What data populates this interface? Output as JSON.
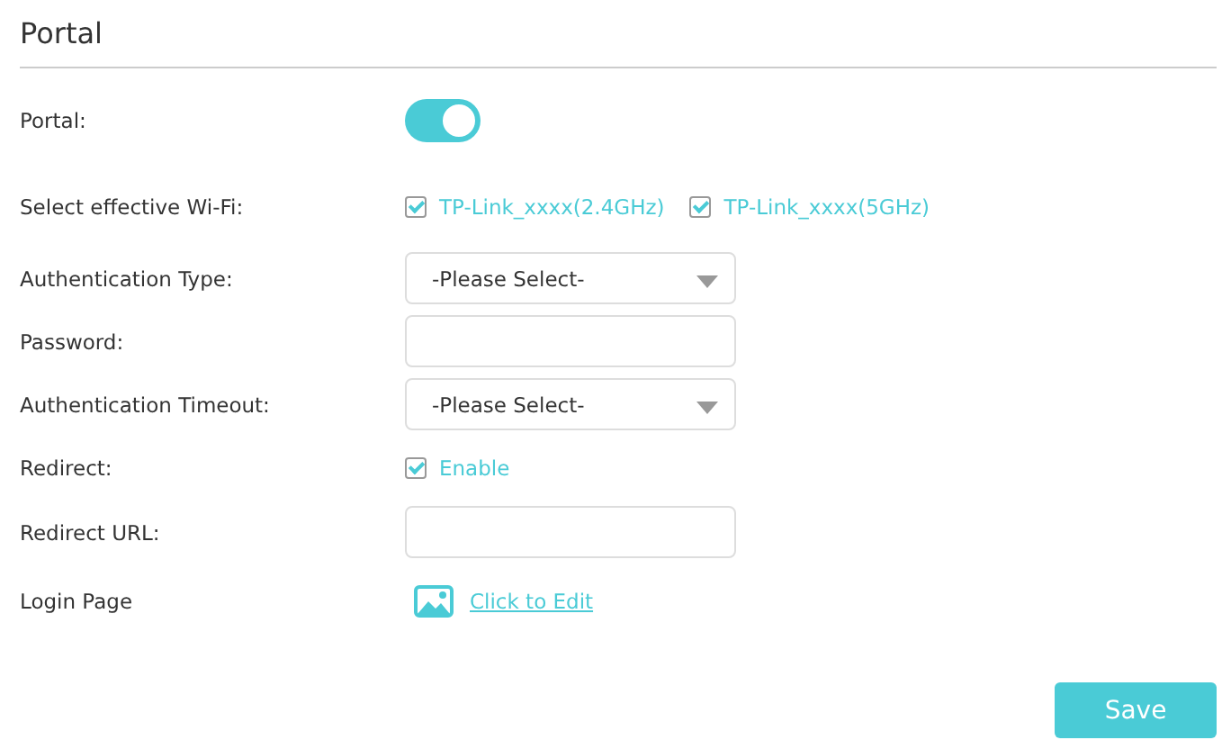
{
  "title": "Portal",
  "rows": [
    {
      "kind": "toggle",
      "label": "Portal:",
      "on": true
    },
    {
      "kind": "checkboxes",
      "label": "Select effective Wi-Fi:",
      "options": [
        {
          "label": "TP-Link_xxxx(2.4GHz)",
          "checked": true
        },
        {
          "label": "TP-Link_xxxx(5GHz)",
          "checked": true
        }
      ]
    },
    {
      "kind": "select",
      "label": "Authentication Type:",
      "value": "-Please Select-"
    },
    {
      "kind": "input",
      "label": "Password:"
    },
    {
      "kind": "select",
      "label": "Authentication Timeout:",
      "value": "-Please Select-"
    },
    {
      "kind": "checkboxes",
      "label": "Redirect:",
      "options": [
        {
          "label": "Enable",
          "checked": true
        }
      ]
    },
    {
      "kind": "input",
      "label": "Redirect URL:"
    },
    {
      "kind": "link",
      "label": "Login Page",
      "link": "Click to Edit"
    }
  ],
  "buttons": [
    "Save"
  ]
}
